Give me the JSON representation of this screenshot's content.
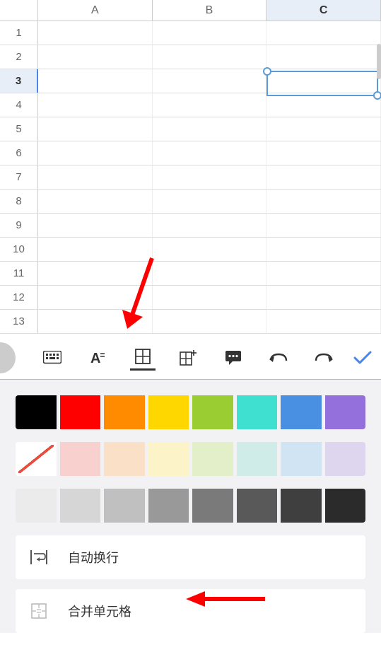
{
  "columns": [
    "A",
    "B",
    "C"
  ],
  "selected_column_index": 2,
  "rows": [
    1,
    2,
    3,
    4,
    5,
    6,
    7,
    8,
    9,
    10,
    11,
    12,
    13
  ],
  "selected_row_index": 2,
  "selected_cell": "C3",
  "toolbar": {
    "keyboard": "keyboard",
    "text_format": "A",
    "cell_format": "cell",
    "insert": "insert",
    "comment": "comment",
    "undo": "undo",
    "redo": "redo",
    "confirm": "confirm"
  },
  "color_palette": {
    "row1": [
      "#000000",
      "#ff0000",
      "#ff8c00",
      "#ffd700",
      "#9acd32",
      "#40e0d0",
      "#4a90e2",
      "#9370db"
    ],
    "row2": [
      "no-fill",
      "#f8d0cd",
      "#fbe0c8",
      "#fdf3c8",
      "#e2efc8",
      "#d0ece8",
      "#d0e4f4",
      "#ded6ef"
    ],
    "row3": [
      "#ebebeb",
      "#d6d6d6",
      "#c0c0c0",
      "#999999",
      "#7a7a7a",
      "#595959",
      "#3f3f3f",
      "#2b2b2b"
    ]
  },
  "options": {
    "wrap_text": "自动换行",
    "merge_cells": "合并单元格"
  }
}
